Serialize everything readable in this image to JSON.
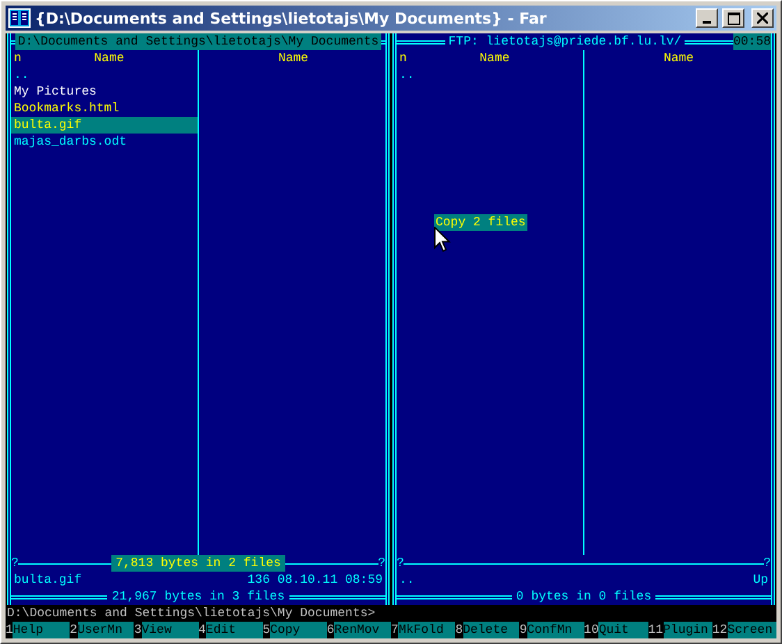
{
  "window": {
    "title": "{D:\\Documents and Settings\\lietotajs\\My Documents} - Far"
  },
  "panels": [
    {
      "title": "D:\\Documents and Settings\\lietotajs\\My Documents",
      "active": true,
      "columns": [
        {
          "labels": [
            "n",
            "Name"
          ]
        },
        {
          "labels": [
            "Name"
          ]
        }
      ],
      "files": [
        {
          "name": "..",
          "kind": "up",
          "selected": false,
          "cursor": false
        },
        {
          "name": "My Pictures",
          "kind": "folder",
          "selected": false,
          "cursor": false
        },
        {
          "name": "Bookmarks.html",
          "kind": "file",
          "selected": true,
          "cursor": false
        },
        {
          "name": "bulta.gif",
          "kind": "file",
          "selected": true,
          "cursor": true
        },
        {
          "name": "majas_darbs.odt",
          "kind": "file",
          "selected": false,
          "cursor": false
        }
      ],
      "sep_marks": [
        "?",
        "?"
      ],
      "selection_info": "7,813 bytes in 2 files",
      "info": {
        "name": "bulta.gif",
        "details": "136 08.10.11 08:59"
      },
      "total": "21,967 bytes in 3 files"
    },
    {
      "title": "FTP: lietotajs@priede.bf.lu.lv/",
      "active": false,
      "clock": "00:58",
      "columns": [
        {
          "labels": [
            "n",
            "Name"
          ]
        },
        {
          "labels": [
            "Name"
          ]
        }
      ],
      "files": [
        {
          "name": "..",
          "kind": "up",
          "selected": false,
          "cursor": false
        }
      ],
      "sep_marks": [
        "?",
        "?"
      ],
      "info": {
        "name": "..",
        "details": "Up"
      },
      "total": "0 bytes in 0 files",
      "dialog": {
        "text": "Copy 2 files"
      }
    }
  ],
  "command_line": "D:\\Documents and Settings\\lietotajs\\My Documents>",
  "keybar": [
    {
      "key": "1",
      "label": "Help"
    },
    {
      "key": "2",
      "label": "UserMn"
    },
    {
      "key": "3",
      "label": "View"
    },
    {
      "key": "4",
      "label": "Edit"
    },
    {
      "key": "5",
      "label": "Copy"
    },
    {
      "key": "6",
      "label": "RenMov"
    },
    {
      "key": "7",
      "label": "MkFold"
    },
    {
      "key": "8",
      "label": "Delete"
    },
    {
      "key": "9",
      "label": "ConfMn"
    },
    {
      "key": "10",
      "label": "Quit"
    },
    {
      "key": "11",
      "label": "Plugin"
    },
    {
      "key": "12",
      "label": "Screen"
    }
  ]
}
